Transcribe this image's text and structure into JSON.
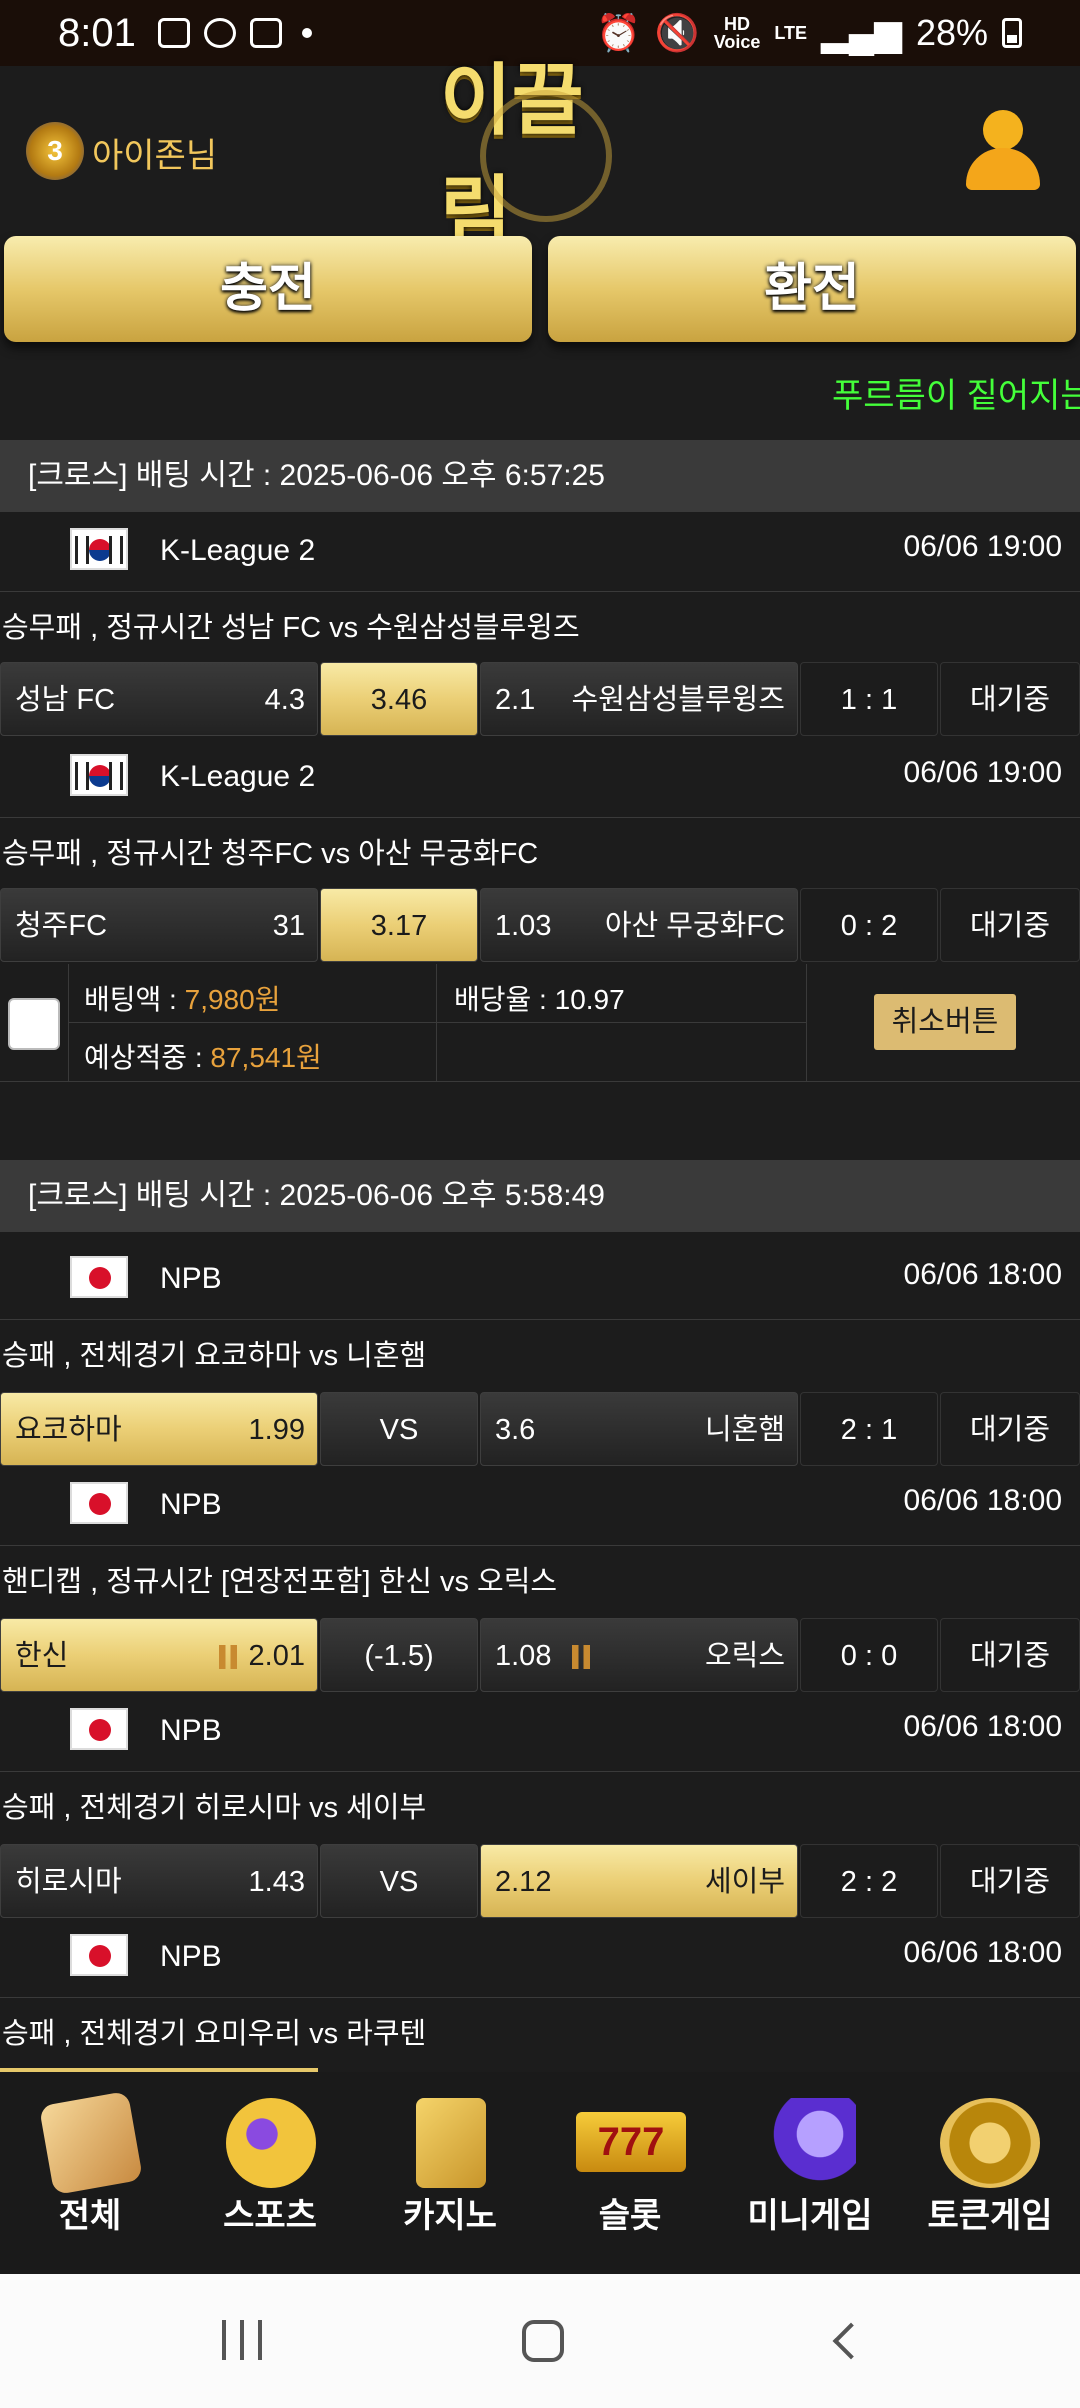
{
  "status": {
    "time": "8:01",
    "battery": "28%",
    "talk": "TALK",
    "hd_voice": "HD\nVoice",
    "lte": "LTE"
  },
  "header": {
    "rank_badge": "3",
    "username": "아이존님",
    "logo": "이끌림"
  },
  "actions": {
    "charge": "충전",
    "exchange": "환전"
  },
  "marquee": "푸르름이 짙어지는",
  "sections": [
    {
      "title": "[크로스] 배팅 시간 : 2025-06-06 오후 6:57:25",
      "games": [
        {
          "flag": "kr",
          "league": "K-League 2",
          "date": "06/06 19:00",
          "desc": "승무패 , 정규시간 성남 FC  vs  수원삼성블루윙즈",
          "home": "성남 FC",
          "home_odds": "4.3",
          "mid": "3.46",
          "away_odds": "2.1",
          "away": "수원삼성블루윙즈",
          "score": "1 : 1",
          "status": "대기중"
        },
        {
          "flag": "kr",
          "league": "K-League 2",
          "date": "06/06 19:00",
          "desc": "승무패 , 정규시간 청주FC  vs  아산 무궁화FC",
          "home": "청주FC",
          "home_odds": "31",
          "mid": "3.17",
          "away_odds": "1.03",
          "away": "아산 무궁화FC",
          "score": "0 : 2",
          "status": "대기중"
        }
      ],
      "bet": {
        "amount_label": "배팅액 : ",
        "amount": "7,980원",
        "rate_label": "배당율 : ",
        "rate": "10.97",
        "expected_label": "예상적중 : ",
        "expected": "87,541원",
        "cancel": "취소버튼"
      }
    },
    {
      "title": "[크로스] 배팅 시간 : 2025-06-06 오후 5:58:49",
      "games": [
        {
          "flag": "jp",
          "league": "NPB",
          "date": "06/06 18:00",
          "desc": "승패 , 전체경기 요코하마  vs  니혼햄",
          "home": "요코하마",
          "home_odds": "1.99",
          "mid": "VS",
          "away_odds": "3.6",
          "away": "니혼햄",
          "score": "2 : 1",
          "status": "대기중"
        },
        {
          "flag": "jp",
          "league": "NPB",
          "date": "06/06 18:00",
          "desc": "핸디캡 , 정규시간 [연장전포함] 한신  vs  오릭스",
          "home": "한신",
          "home_odds": "2.01",
          "mid": "(-1.5)",
          "away_odds": "1.08",
          "away": "오릭스",
          "score": "0 : 0",
          "status": "대기중"
        },
        {
          "flag": "jp",
          "league": "NPB",
          "date": "06/06 18:00",
          "desc": "승패 , 전체경기 히로시마  vs  세이부",
          "home": "히로시마",
          "home_odds": "1.43",
          "mid": "VS",
          "away_odds": "2.12",
          "away": "세이부",
          "score": "2 : 2",
          "status": "대기중"
        },
        {
          "flag": "jp",
          "league": "NPB",
          "date": "06/06 18:00",
          "desc": "승패 , 전체경기 요미우리  vs  라쿠텐"
        }
      ]
    }
  ],
  "bottom_nav": [
    {
      "label": "전체",
      "icon": "dice-icon"
    },
    {
      "label": "스포츠",
      "icon": "soccer-ball-icon"
    },
    {
      "label": "카지노",
      "icon": "cards-icon"
    },
    {
      "label": "슬롯",
      "icon": "slot-777-icon",
      "glyph": "777"
    },
    {
      "label": "미니게임",
      "icon": "rocket-icon"
    },
    {
      "label": "토큰게임",
      "icon": "roulette-icon"
    }
  ]
}
